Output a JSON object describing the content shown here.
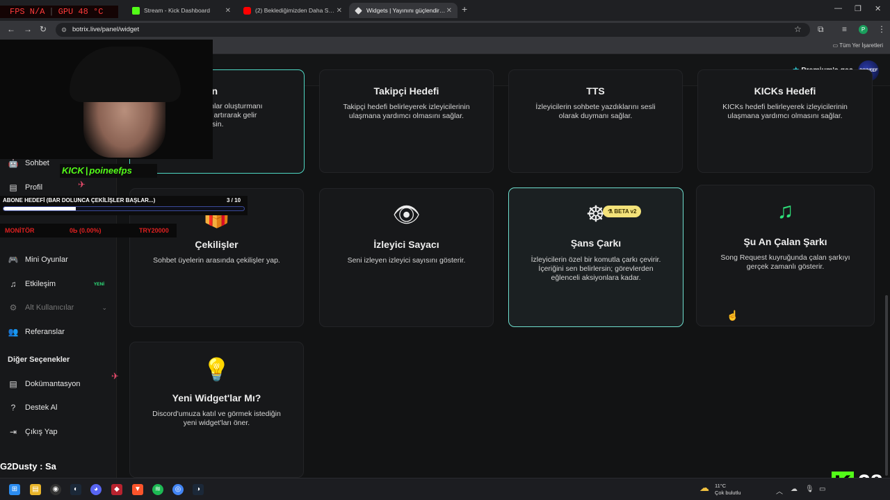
{
  "browser": {
    "tabs": [
      {
        "title": "Stream - Kick Dashboard",
        "favicon_color": "#53fc18"
      },
      {
        "title": "(2) Beklediğimizden Daha Sam...",
        "favicon_color": "#ff0000"
      },
      {
        "title": "Widgets | Yayınını güçlendirme...",
        "favicon_color": "#dddddd",
        "active": true
      }
    ],
    "url": "botrix.live/panel/widget",
    "bookmarks_label": "Tüm Yer İşaretleri",
    "profile_initial": "P"
  },
  "header": {
    "premium_label": "Premium'a geç",
    "logo_text": "POINEEF"
  },
  "sidebar": {
    "items": [
      {
        "label": "Sohbet",
        "icon": "robot-icon"
      },
      {
        "label": "Profil",
        "icon": "id-card-icon"
      },
      {
        "label": "Mini Oyunlar",
        "icon": "gamepad-icon"
      },
      {
        "label": "Etkileşim",
        "icon": "music-icon",
        "badge": "YENİ"
      },
      {
        "label": "Alt Kullanıcılar",
        "icon": "users-cog-icon",
        "disabled": true
      },
      {
        "label": "Referanslar",
        "icon": "users-icon"
      }
    ],
    "other_heading": "Diğer Seçenekler",
    "other_items": [
      {
        "label": "Dokümantasyon",
        "icon": "book-icon"
      },
      {
        "label": "Destek Al",
        "icon": "question-icon"
      },
      {
        "label": "Çıkış Yap",
        "icon": "logout-icon"
      }
    ]
  },
  "widgets": [
    {
      "title": "athon",
      "desc": "yayınlar oluşturmanı\nesini artırarak gelir\nabilirsin.",
      "partial": true
    },
    {
      "title": "Takipçi Hedefi",
      "desc": "Takipçi hedefi belirleyerek izleyicilerinin\nulaşmana yardımcı olmasını sağlar."
    },
    {
      "title": "TTS",
      "desc": "İzleyicilerin sohbete yazdıklarını sesli\nolarak duymanı sağlar."
    },
    {
      "title": "KICKs Hedefi",
      "desc": "KICKs hedefi belirleyerek izleyicilerinin\nulaşmana yardımcı olmasını sağlar."
    },
    {
      "title": "Çekilişler",
      "desc": "Sohbet üyelerin arasında çekilişler yap.",
      "icon": "gift-icon"
    },
    {
      "title": "İzleyici Sayacı",
      "desc": "Seni izleyen izleyici sayısını gösterir.",
      "icon": "eye-icon"
    },
    {
      "title": "Şans Çarkı",
      "desc": "İzleyicilerin özel bir komutla çarkı çevirir.\nİçeriğini sen belirlersin; görevlerden\neğlenceli aksiyonlara kadar.",
      "icon": "wheel-icon",
      "badge": "BETA v2"
    },
    {
      "title": "Şu An Çalan Şarkı",
      "desc": "Song Request kuyruğunda çalan şarkıyı\ngerçek zamanlı gösterir.",
      "icon": "music-note-icon",
      "icon_color": "#2ee07a"
    },
    {
      "title": "Yeni Widget'lar Mı?",
      "desc": "Discord'umuza katıl ve görmek istediğin\nyeni widget'ları öner.",
      "icon": "lightbulb-icon"
    }
  ],
  "overlay": {
    "fps_text": "FPS N/A",
    "gpu_text": "GPU 48 °C",
    "kick_brand": "KICK",
    "channel": "poineefps",
    "sub_goal_label": "ABONE HEDEFİ (BAR DOLUNCA ÇEKİLİŞLER BAŞLAR...)",
    "sub_goal_count": "3  / 10",
    "sub_goal_progress": 0.3,
    "monitor_label": "MONİTÖR",
    "monitor_value": "0Ь (0.00%)",
    "monitor_target": "TRY20000",
    "chat_line": "G2Dusty : Sa",
    "kick_count": "28"
  },
  "taskbar": {
    "weather_temp": "11°C",
    "weather_desc": "Çok bulutlu"
  }
}
